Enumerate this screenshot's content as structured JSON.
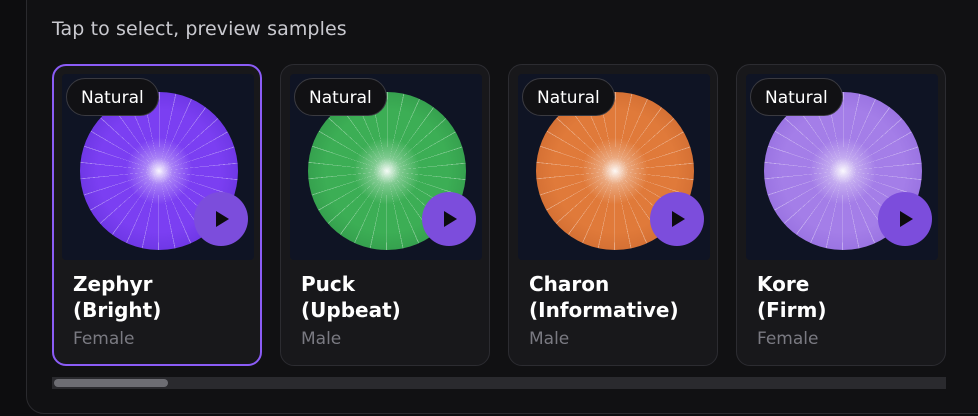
{
  "hint": "Tap to select, preview samples",
  "accent": "#8b5cf6",
  "play_icon": "play-icon",
  "voices": [
    {
      "badge": "Natural",
      "name_line1": "Zephyr",
      "name_line2": "(Bright)",
      "gender": "Female",
      "selected": true,
      "orb_color": "#7b3ff2",
      "orb_edge": "#5a2ad0"
    },
    {
      "badge": "Natural",
      "name_line1": "Puck",
      "name_line2": "(Upbeat)",
      "gender": "Male",
      "selected": false,
      "orb_color": "#3cae55",
      "orb_edge": "#2a8a42"
    },
    {
      "badge": "Natural",
      "name_line1": "Charon",
      "name_line2": "(Informative)",
      "gender": "Male",
      "selected": false,
      "orb_color": "#e07a3a",
      "orb_edge": "#c2602a"
    },
    {
      "badge": "Natural",
      "name_line1": "Kore",
      "name_line2": "(Firm)",
      "gender": "Female",
      "selected": false,
      "orb_color": "#a47ee8",
      "orb_edge": "#8a62d8"
    }
  ]
}
